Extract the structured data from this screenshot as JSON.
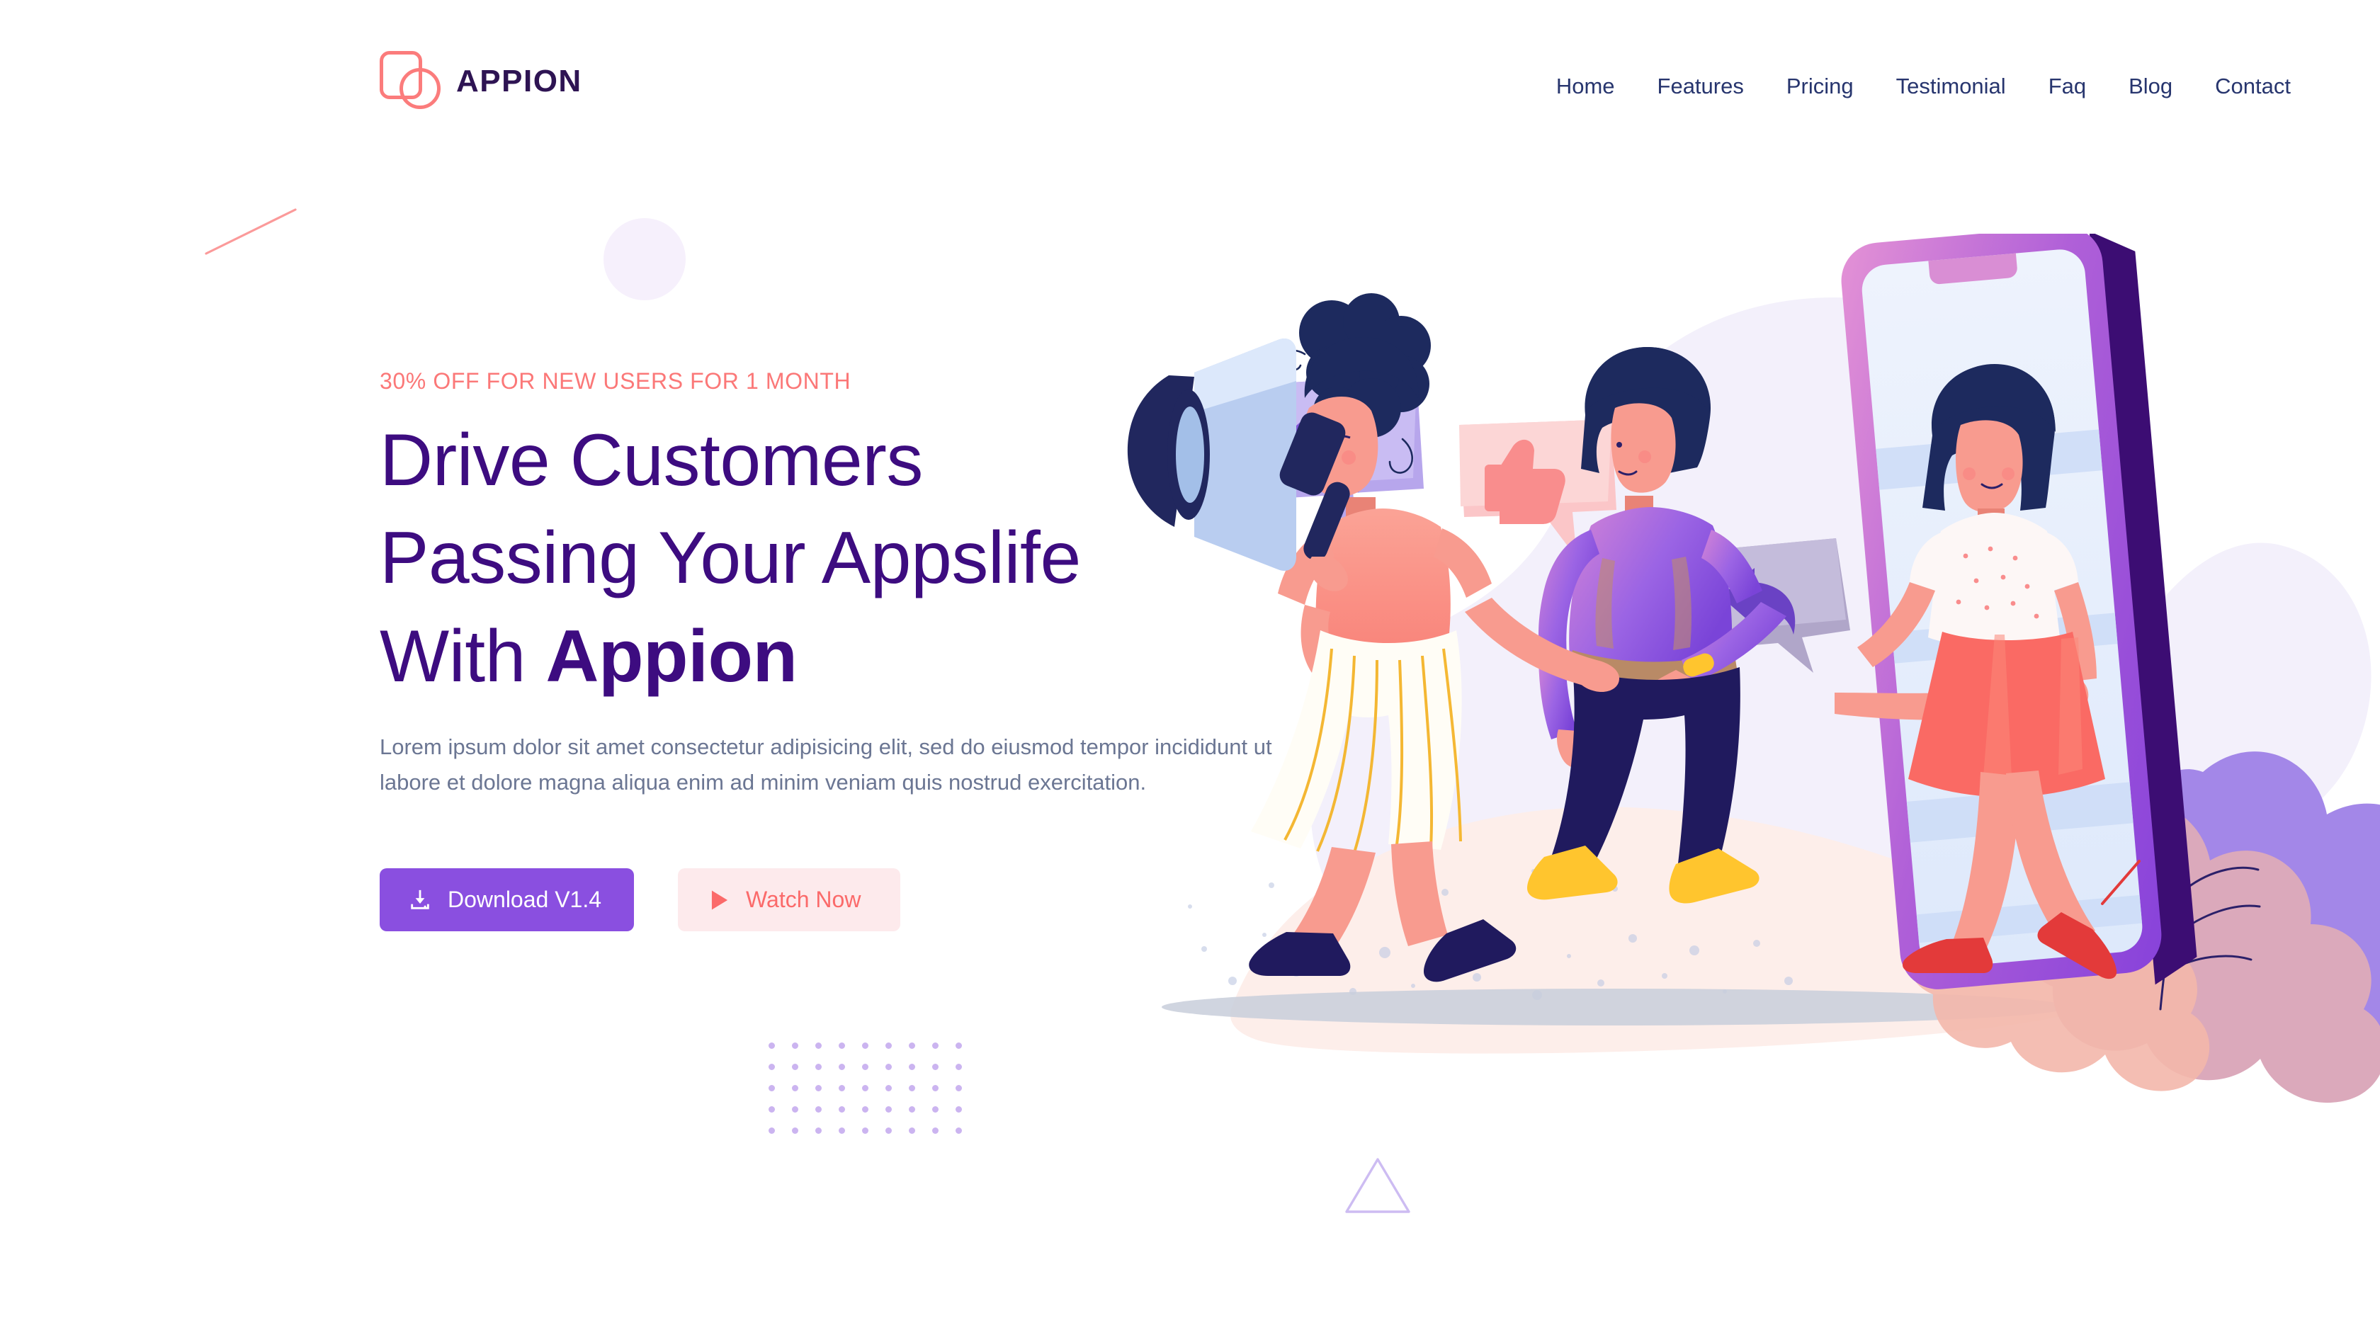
{
  "brand": {
    "name": "APPION",
    "logo_icon": "appion-logo-square-circle",
    "logo_color": "#fb7c7c",
    "text_color": "#2e1453"
  },
  "nav": {
    "items": [
      {
        "label": "Home"
      },
      {
        "label": "Features"
      },
      {
        "label": "Pricing"
      },
      {
        "label": "Testimonial"
      },
      {
        "label": "Faq"
      },
      {
        "label": "Blog"
      },
      {
        "label": "Contact"
      }
    ],
    "text_color": "#27356e"
  },
  "hero": {
    "eyebrow": "30% OFF FOR NEW USERS FOR 1 MONTH",
    "eyebrow_color": "#fb7878",
    "headline_line1": "Drive Customers",
    "headline_line2": "Passing Your Appslife",
    "headline_line3_light": "With ",
    "headline_line3_bold": "Appion",
    "headline_color": "#3d0c80",
    "paragraph": "Lorem ipsum dolor sit amet consectetur adipisicing elit, sed do eiusmod tempor incididunt ut labore et dolore magna aliqua enim ad minim veniam quis nostrud exercitation.",
    "paragraph_color": "#6b7693",
    "primary_button": {
      "label": "Download V1.4",
      "icon": "download-icon",
      "bg": "#8a4fe0",
      "fg": "#ffffff"
    },
    "secondary_button": {
      "label": "Watch Now",
      "icon": "play-icon",
      "bg": "#fdeaec",
      "fg": "#fb6a6a"
    }
  },
  "decorations": {
    "diagonal_line_color": "#fb9a9a",
    "circle_color": "#f6f0fc",
    "triangle_color": "#cdbcf2",
    "dot_grid_color": "#cbb4f0",
    "dot_grid_rows": 5,
    "dot_grid_cols": 9
  },
  "illustration": {
    "name": "people-walking-out-of-smartphone",
    "elements": [
      "speech-bubble-share-arrow-purple",
      "speech-bubble-thumbs-up-pink",
      "speech-bubble-share-arrow-gray",
      "woman-with-megaphone",
      "man-in-purple-sweater",
      "woman-stepping-out-of-phone",
      "large-tilted-smartphone",
      "foliage-bushes"
    ],
    "palette": {
      "blob_lavender": "#f3f0fb",
      "blob_pink": "#fdeeea",
      "phone_frame": "#9a5ce0",
      "phone_frame_light": "#d98ed4",
      "phone_frame_dark": "#3c0d73",
      "phone_screen": "#e6eefc",
      "skin": "#f89b8f",
      "hair_navy": "#1d2a5e",
      "skirt_coral": "#fa6a64",
      "sweater_purple": "#9461e0",
      "shoe_yellow": "#ffc52e",
      "bush_purple": "#a387e8",
      "bush_pink": "#d9a3b6",
      "ground_shadow": "#c8cedb"
    }
  }
}
